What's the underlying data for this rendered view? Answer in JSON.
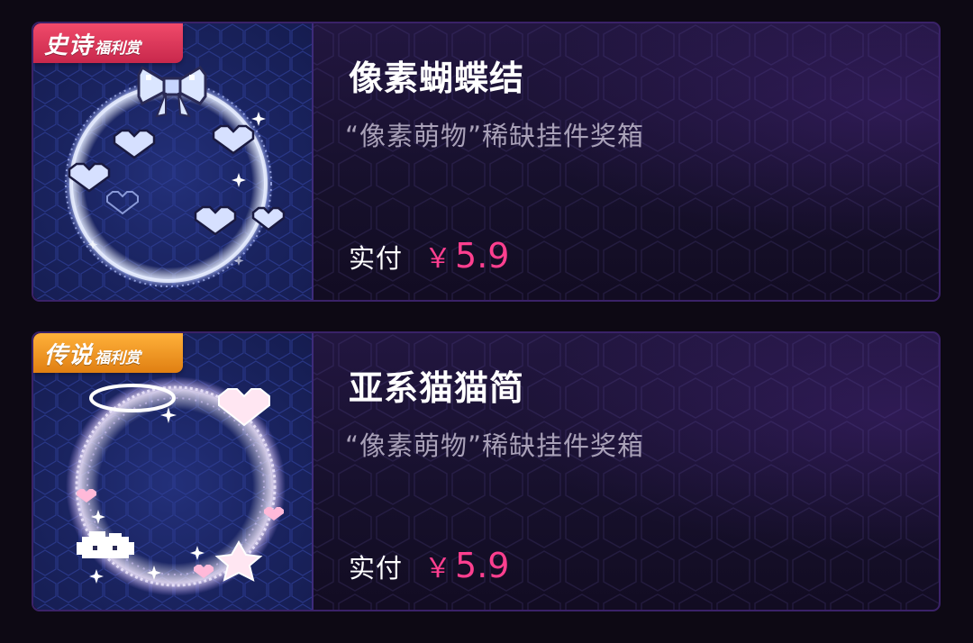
{
  "items": [
    {
      "badge_main": "史诗",
      "badge_sub": "福利赏",
      "badge_color": "#e0365c",
      "title": "像素蝴蝶结",
      "subtitle": "“像素萌物”稀缺挂件奖箱",
      "price_label": "实付",
      "currency": "￥",
      "price": "5.9",
      "icon": "pixel-bow-frame"
    },
    {
      "badge_main": "传说",
      "badge_sub": "福利赏",
      "badge_color": "#f39a22",
      "title": "亚系猫猫简",
      "subtitle": "“像素萌物”稀缺挂件奖箱",
      "price_label": "实付",
      "currency": "￥",
      "price": "5.9",
      "icon": "pixel-halo-frame"
    }
  ],
  "colors": {
    "price": "#ff3f8f",
    "background": "#0d0914"
  }
}
